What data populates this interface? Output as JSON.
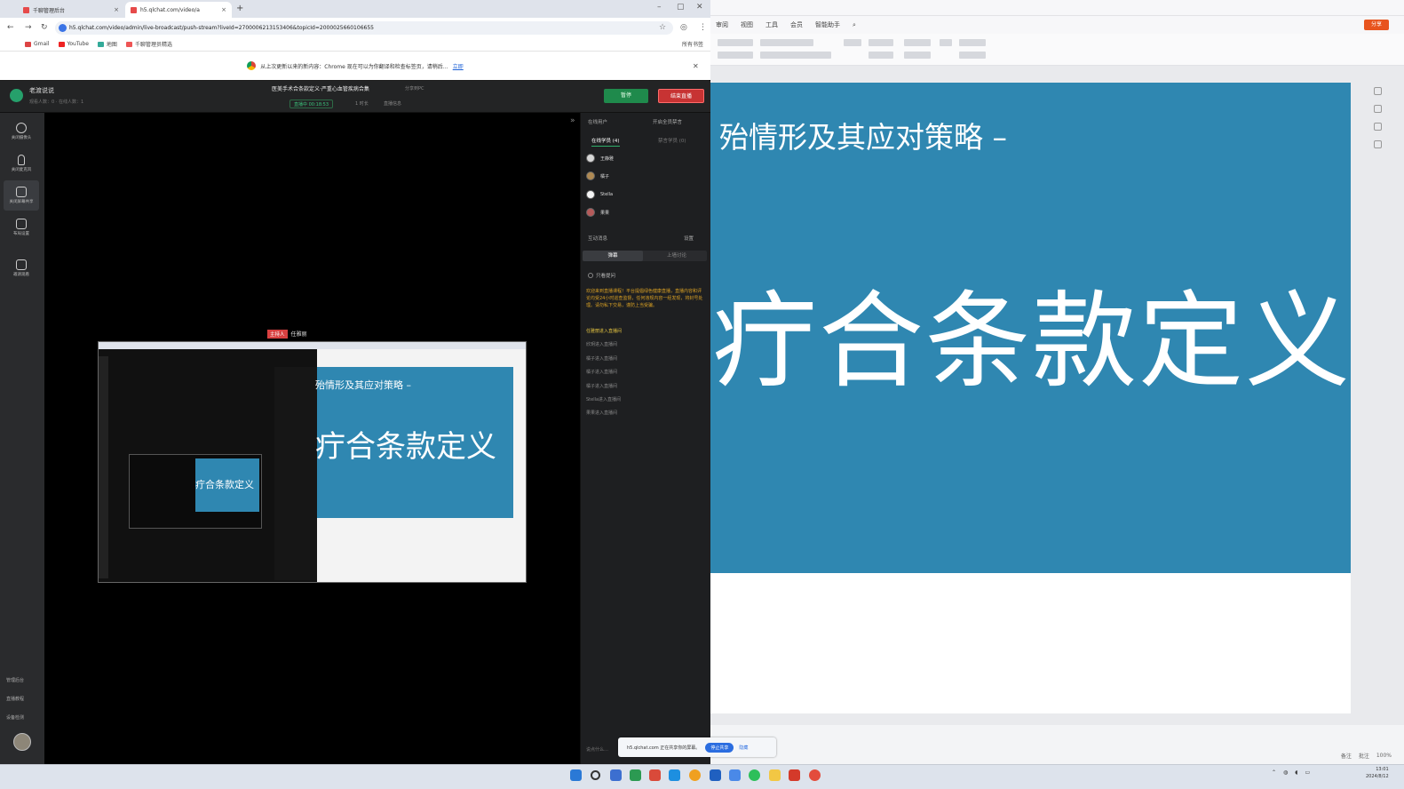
{
  "browser": {
    "tabs": [
      {
        "label": "千聊管理后台"
      },
      {
        "label": "h5.qlchat.com/video/a"
      }
    ],
    "new_tab": "+",
    "url": "h5.qlchat.com/video/admin/live-broadcast/push-stream?liveId=2700006213153406&topicId=2000025660106655",
    "bookmarks": [
      "Gmail",
      "YouTube",
      "地图",
      "千聊管理员精选"
    ],
    "all_bookmarks": "所有书签",
    "infobar_text": "从上次更新以来的新内容：Chrome 现在可以为你翻译和检查标签页，请稍后…",
    "infobar_link": "立即"
  },
  "console": {
    "room_name": "老渡说说",
    "room_sub": "观看人数：0  ·  在线人数：1",
    "live_title": "医美手术合条款定义·严重心血管疾病合集",
    "share_pc": "分享到PC",
    "live_status": "直播中 00:18:53",
    "meta1": "1 时长",
    "meta2": "直播信息",
    "pause": "暂停",
    "end": "结束直播",
    "left_menu": [
      {
        "label": "关闭摄像头"
      },
      {
        "label": "关闭麦克风"
      },
      {
        "label": "关闭屏幕共享"
      },
      {
        "label": "布局设置"
      },
      {
        "label": "邀请观看"
      }
    ],
    "left_bottom": [
      "管理后台",
      "直播教程",
      "设备检测"
    ],
    "presenter_badge": "主持人",
    "presenter_name": "任雅丽",
    "right_panel": {
      "header_left": "在线用户",
      "header_right": "开启全员禁言",
      "tab_online": "在线学员 (4)",
      "tab_banned": "禁言学员 (0)",
      "users": [
        {
          "name": "王静雅"
        },
        {
          "name": "橘子"
        },
        {
          "name": "Stella"
        },
        {
          "name": "果果"
        }
      ],
      "interaction_label": "互动消息",
      "settings_label": "设置",
      "chat_tab_a": "弹幕",
      "chat_tab_b": "上墙讨论",
      "only_questions": "只看提问",
      "notice": "欢迎来到直播课程！平台提倡绿色健康直播，直播内容和评论均受24小时巡查监督，任何违规内容一经发现，将封号处理。请勿私下交易，谨防上当受骗。",
      "joined_highlight": "任雅丽进入直播间",
      "joined": [
        "任雅丽进入直播间",
        "欣玥进入直播间",
        "橘子进入直播间",
        "橘子进入直播间",
        "橘子进入直播间",
        "Stella进入直播间",
        "果果进入直播间"
      ],
      "chat_input": "说点什么…"
    },
    "share_bar": {
      "text": "h5.qlchat.com 正在共享你的屏幕。",
      "stop": "停止共享",
      "hide": "隐藏"
    }
  },
  "wps": {
    "menu": [
      "审阅",
      "视图",
      "工具",
      "会员",
      "智能助手"
    ],
    "share": "分享",
    "slide_title": "殆情形及其应对策略 –",
    "slide_big": "疔合条款定义",
    "status": [
      "备注",
      "批注",
      "100%"
    ]
  },
  "taskbar": {
    "clock_time": "13:01",
    "clock_date": "2024/8/12"
  },
  "colors": {
    "slide_blue": "#2f87b1",
    "end_red": "#c73333",
    "pause_green": "#1f8a4c",
    "notice_orange": "#d9a023"
  }
}
